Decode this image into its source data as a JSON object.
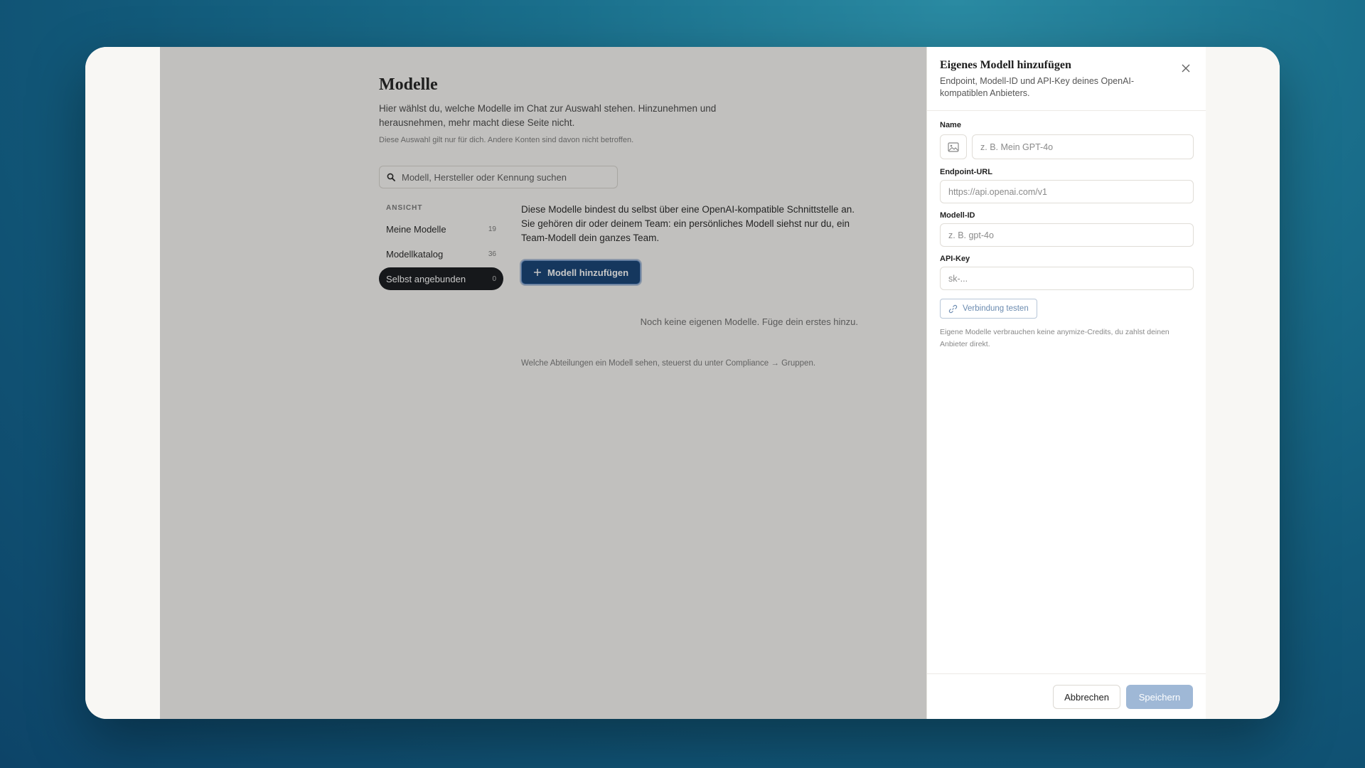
{
  "page": {
    "title": "Modelle",
    "description": "Hier wählst du, welche Modelle im Chat zur Auswahl stehen. Hinzunehmen und herausnehmen, mehr macht diese Seite nicht.",
    "note": "Diese Auswahl gilt nur für dich. Andere Konten sind davon nicht betroffen."
  },
  "search": {
    "placeholder": "Modell, Hersteller oder Kennung suchen"
  },
  "sidebar": {
    "section_label": "ANSICHT",
    "items": [
      {
        "label": "Meine Modelle",
        "count": "19"
      },
      {
        "label": "Modellkatalog",
        "count": "36"
      },
      {
        "label": "Selbst angebunden",
        "count": "0"
      }
    ]
  },
  "main": {
    "info": "Diese Modelle bindest du selbst über eine OpenAI-kompatible Schnittstelle an. Sie gehören dir oder deinem Team: ein persönliches Modell siehst nur du, ein Team-Modell dein ganzes Team.",
    "add_button": "Modell hinzufügen",
    "empty": "Noch keine eigenen Modelle. Füge dein erstes hinzu.",
    "footer_note": "Welche Abteilungen ein Modell sehen, steuerst du unter Compliance → Gruppen."
  },
  "drawer": {
    "title": "Eigenes Modell hinzufügen",
    "subtitle": "Endpoint, Modell-ID und API-Key deines OpenAI-kompatiblen Anbieters.",
    "fields": {
      "name": {
        "label": "Name",
        "placeholder": "z. B. Mein GPT-4o"
      },
      "endpoint": {
        "label": "Endpoint-URL",
        "placeholder": "https://api.openai.com/v1"
      },
      "model_id": {
        "label": "Modell-ID",
        "placeholder": "z. B. gpt-4o"
      },
      "api_key": {
        "label": "API-Key",
        "placeholder": "sk-..."
      }
    },
    "test_button": "Verbindung testen",
    "note": "Eigene Modelle verbrauchen keine anymize-Credits, du zahlst deinen Anbieter direkt.",
    "cancel": "Abbrechen",
    "save": "Speichern"
  }
}
